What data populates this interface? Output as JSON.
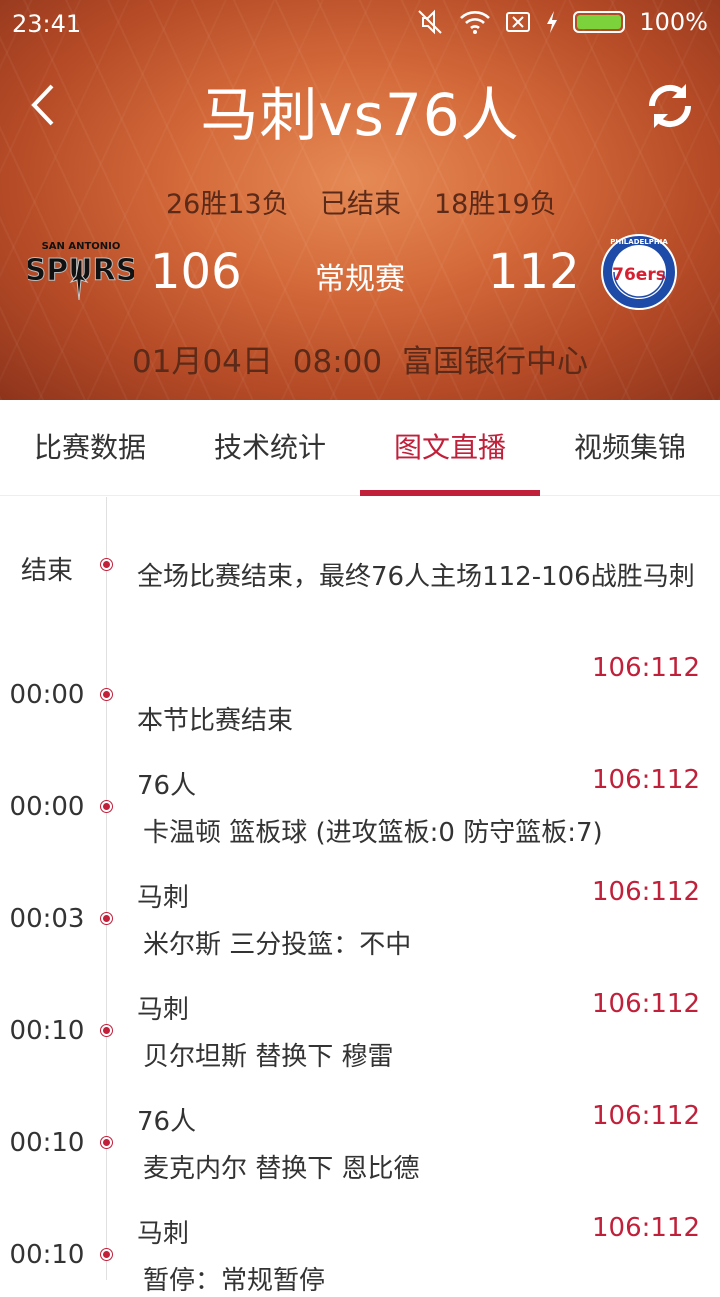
{
  "status_bar": {
    "time": "23:41",
    "battery": "100%",
    "icons": [
      "mute-icon",
      "wifi-icon",
      "no-sim-icon",
      "charging-icon",
      "battery-icon"
    ]
  },
  "header": {
    "title": "马刺vs76人",
    "home_record": "26胜13负",
    "state": "已结束",
    "away_record": "18胜19负",
    "left_team_logo": "San Antonio Spurs",
    "left_logo_top_text": "SAN ANTONIO",
    "left_logo_text": "SPURS",
    "right_team_logo": "Philadelphia 76ers",
    "right_logo_ring_text": "PHILADELPHIA",
    "right_logo_text": "76ers",
    "left_score": "106",
    "game_type": "常规赛",
    "right_score": "112",
    "date": "01月04日",
    "time": "08:00",
    "venue": "富国银行中心"
  },
  "tabs": [
    {
      "label": "比赛数据"
    },
    {
      "label": "技术统计"
    },
    {
      "label": "图文直播",
      "active": true
    },
    {
      "label": "视频集锦"
    }
  ],
  "events": [
    {
      "time": "结束",
      "team": "",
      "score": "",
      "desc": "全场比赛结束，最终76人主场112-106战胜马刺"
    },
    {
      "time": "00:00",
      "team": "",
      "score": "106:112",
      "desc": "本节比赛结束"
    },
    {
      "time": "00:00",
      "team": "76人",
      "score": "106:112",
      "desc": "卡温顿 篮板球 (进攻篮板:0 防守篮板:7)"
    },
    {
      "time": "00:03",
      "team": "马刺",
      "score": "106:112",
      "desc": "米尔斯 三分投篮：不中"
    },
    {
      "time": "00:10",
      "team": "马刺",
      "score": "106:112",
      "desc": "贝尔坦斯 替换下 穆雷"
    },
    {
      "time": "00:10",
      "team": "76人",
      "score": "106:112",
      "desc": "麦克内尔 替换下 恩比德"
    },
    {
      "time": "00:10",
      "team": "马刺",
      "score": "106:112",
      "desc": "暂停：常规暂停"
    }
  ],
  "colors": {
    "accent": "#c0203a",
    "header_bg": "#c8582e"
  }
}
